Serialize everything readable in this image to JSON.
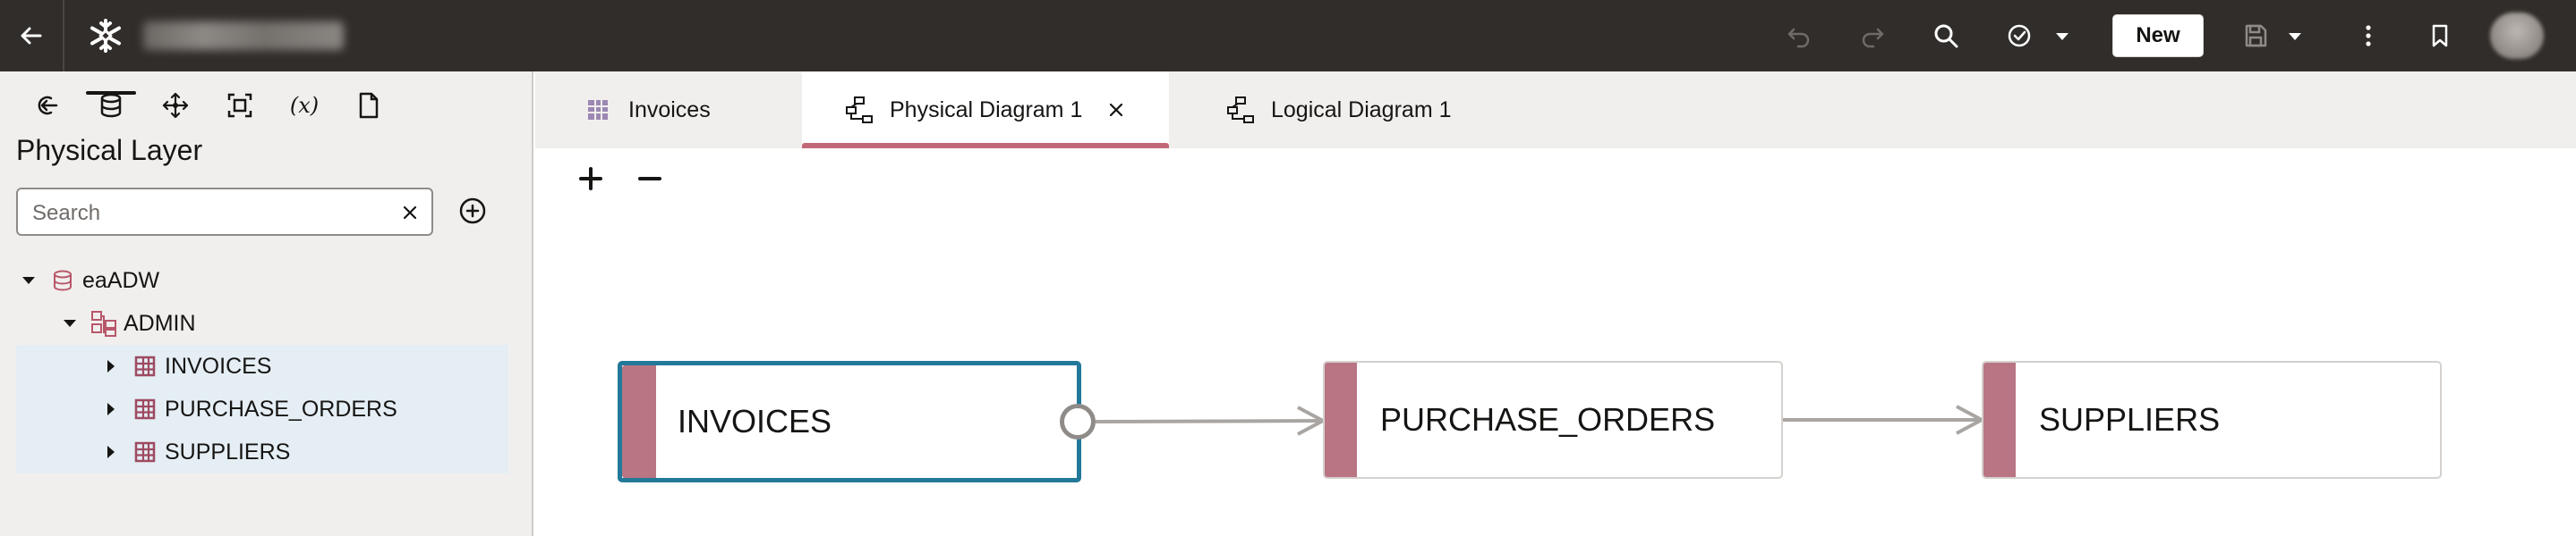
{
  "topbar": {
    "new_label": "New",
    "icons": [
      "back-arrow-icon",
      "snowflake-logo-icon",
      "undo-icon",
      "redo-icon",
      "search-icon",
      "check-circle-icon",
      "chevron-down-icon",
      "save-icon",
      "more-vertical-icon",
      "bookmark-icon"
    ]
  },
  "left_panel": {
    "title": "Physical Layer",
    "tools": [
      "connect-back-icon",
      "database-icon",
      "move-icon",
      "frame-icon",
      "variable-icon",
      "document-icon"
    ],
    "search": {
      "placeholder": "Search",
      "value": ""
    },
    "tree": [
      {
        "label": "eaADW",
        "level": 0,
        "expanded": true,
        "icon": "database-icon"
      },
      {
        "label": "ADMIN",
        "level": 1,
        "expanded": true,
        "icon": "schema-icon"
      },
      {
        "label": "INVOICES",
        "level": 2,
        "expanded": false,
        "icon": "table-icon"
      },
      {
        "label": "PURCHASE_ORDERS",
        "level": 2,
        "expanded": false,
        "icon": "table-icon"
      },
      {
        "label": "SUPPLIERS",
        "level": 2,
        "expanded": false,
        "icon": "table-icon"
      }
    ]
  },
  "tabs": [
    {
      "label": "Invoices",
      "icon": "table-icon",
      "active": false
    },
    {
      "label": "Physical Diagram 1",
      "icon": "diagram-icon",
      "active": true,
      "closable": true
    },
    {
      "label": "Logical Diagram 1",
      "icon": "diagram-icon",
      "active": false
    }
  ],
  "diagram": {
    "nodes": [
      {
        "label": "INVOICES",
        "selected": true
      },
      {
        "label": "PURCHASE_ORDERS",
        "selected": false
      },
      {
        "label": "SUPPLIERS",
        "selected": false
      }
    ],
    "edges": [
      {
        "from": "INVOICES",
        "to": "PURCHASE_ORDERS"
      },
      {
        "from": "PURCHASE_ORDERS",
        "to": "SUPPLIERS"
      }
    ]
  },
  "colors": {
    "topbar_bg": "#312d2a",
    "panel_bg": "#f1efed",
    "accent_tab": "#c26977",
    "node_bar": "#b97584",
    "selected_border": "#22799a",
    "tree_selection": "#e4eef4"
  }
}
